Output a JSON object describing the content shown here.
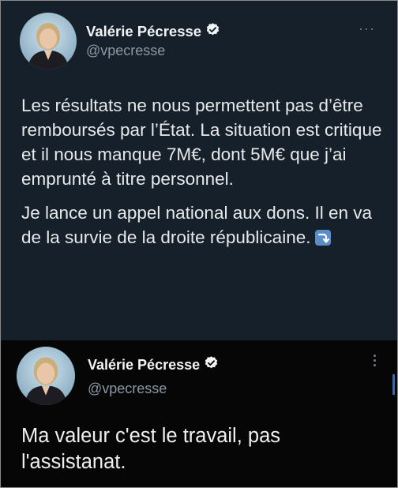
{
  "tweets": [
    {
      "author_name": "Valérie Pécresse",
      "handle": "@vpecresse",
      "paragraphs": [
        "Les résultats ne nous permettent pas d’être remboursés par l’État. La situation est critique et il nous manque 7M€, dont 5M€ que j’ai emprunté à titre personnel.",
        "Je lance un appel national aux dons. Il en va de la survie de la droite républicaine."
      ],
      "more_icon": "more-horizontal-icon",
      "verified_icon": "verified-badge-icon",
      "emoji_icon": "arrow-right-curving-down-icon"
    },
    {
      "author_name": "Valérie Pécresse",
      "handle": "@vpecresse",
      "text": "Ma valeur c'est le travail, pas l'assistanat.",
      "more_icon": "more-vertical-icon",
      "verified_icon": "verified-badge-icon"
    }
  ],
  "colors": {
    "tweet1_background": "#15202b",
    "tweet2_background": "#060606",
    "handle_color": "#8b98a5",
    "accent": "#1d6fd6"
  }
}
